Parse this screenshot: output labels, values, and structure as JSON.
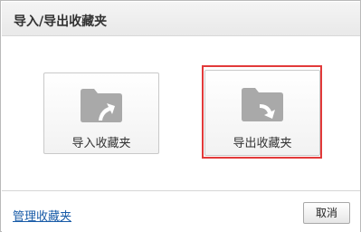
{
  "dialog": {
    "title": "导入/导出收藏夹"
  },
  "options": {
    "import": {
      "label": "导入收藏夹",
      "icon": "folder-import-icon"
    },
    "export": {
      "label": "导出收藏夹",
      "icon": "folder-export-icon",
      "highlighted": true
    }
  },
  "footer": {
    "manage_link": "管理收藏夹",
    "cancel_label": "取消"
  },
  "colors": {
    "highlight": "#e23a3a",
    "link": "#1a5ca8",
    "folder_icon": "#a9a9a9"
  }
}
